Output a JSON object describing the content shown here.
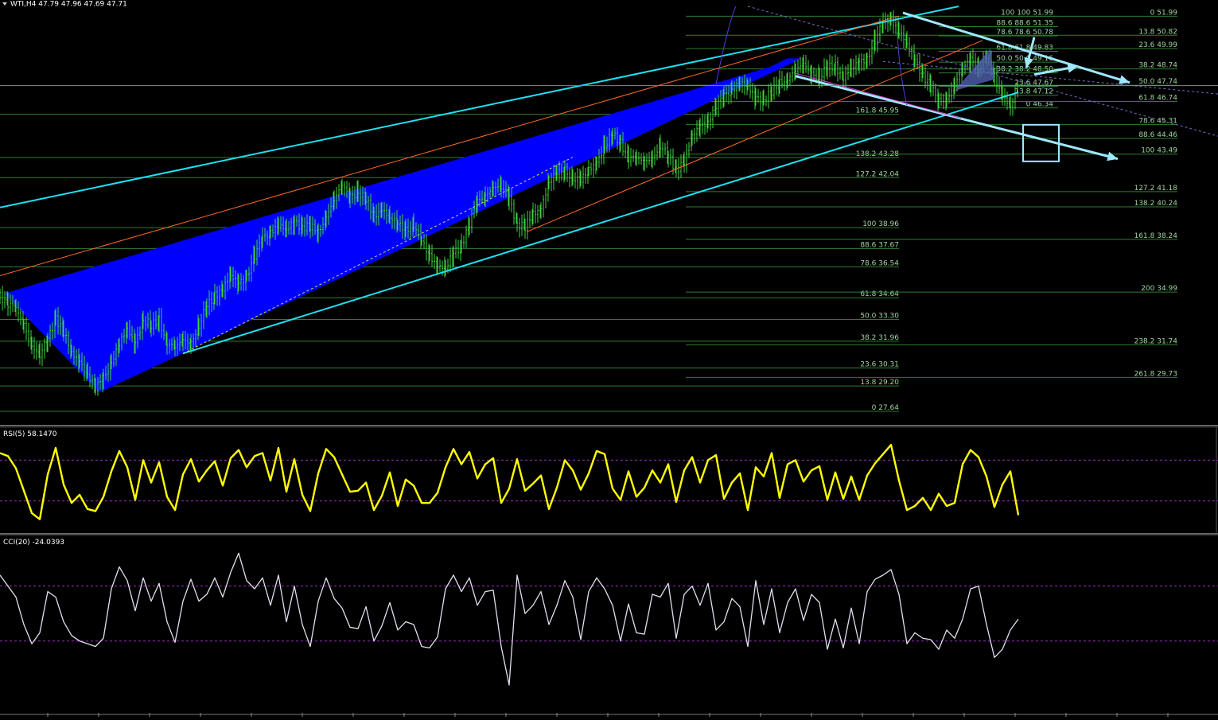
{
  "header": {
    "symbol_line": "WTI,H4  47.79 47.96 47.69 47.71"
  },
  "colors": {
    "background": "#000000",
    "price_candles": "#3fd23f",
    "fib_lines": "#2e7d32",
    "fib_text": "#9fd49f",
    "blue_wedge": "#0000ff",
    "cyan_lines": "#1fe0f0",
    "white_arrows": "#9fe8ff",
    "orange_lines": "#ff6a2a",
    "rsi_line": "#ffff00",
    "cci_line": "#e0e0f0",
    "level_lines": "#9b2fbf"
  },
  "chart_data": [
    {
      "type": "line",
      "name": "WTI H4 price",
      "ylim": [
        27.0,
        52.5
      ],
      "x": [
        0,
        10,
        20,
        30,
        40,
        50,
        60,
        70,
        80,
        90,
        100,
        110,
        120,
        130,
        140,
        150,
        160,
        170,
        180,
        190,
        200,
        210,
        220,
        230,
        240,
        250,
        260,
        270,
        280,
        290,
        300,
        310,
        320,
        330,
        340,
        350,
        360,
        370,
        380,
        390,
        400,
        410,
        420,
        430,
        440,
        450,
        460,
        470,
        480,
        490,
        500,
        510,
        520,
        530,
        540,
        550,
        560,
        570,
        580,
        590,
        600,
        610,
        620,
        630,
        640,
        650,
        660,
        670,
        680,
        690,
        700,
        710,
        720,
        730,
        740,
        750,
        760,
        770,
        780,
        790,
        800,
        810,
        820,
        830,
        840,
        850,
        860,
        870,
        880,
        890,
        900,
        910,
        920,
        930,
        940,
        950,
        960,
        970,
        980,
        990,
        1000,
        1010,
        1020,
        1030,
        1040,
        1050,
        1060,
        1070,
        1080,
        1090,
        1100,
        1110,
        1120,
        1130,
        1140,
        1150,
        1160,
        1170,
        1180,
        1190,
        1200,
        1210,
        1220,
        1230,
        1240,
        1250,
        1260,
        1270,
        1280
      ],
      "y": [
        34.8,
        34.4,
        33.8,
        33.0,
        31.8,
        31.0,
        32.0,
        33.5,
        32.6,
        31.0,
        30.8,
        30.0,
        29.0,
        29.6,
        30.8,
        31.8,
        32.5,
        32.0,
        33.3,
        32.8,
        33.2,
        32.0,
        31.5,
        31.9,
        32.0,
        32.9,
        34.0,
        34.8,
        35.4,
        35.8,
        35.5,
        36.1,
        37.2,
        38.2,
        38.8,
        39.2,
        38.6,
        39.4,
        39.1,
        39.0,
        38.5,
        39.8,
        40.7,
        41.4,
        41.0,
        41.2,
        40.6,
        39.6,
        40.3,
        39.5,
        39.1,
        38.9,
        39.2,
        38.0,
        37.2,
        36.8,
        36.3,
        37.3,
        38.0,
        39.3,
        40.4,
        41.0,
        41.6,
        41.3,
        40.8,
        39.3,
        39.0,
        39.6,
        40.3,
        41.8,
        42.2,
        42.5,
        42.1,
        41.8,
        42.4,
        43.2,
        43.9,
        44.6,
        44.2,
        43.4,
        43.1,
        43.0,
        43.4,
        43.9,
        43.3,
        42.6,
        43.2,
        44.4,
        45.3,
        45.6,
        46.4,
        47.0,
        47.6,
        47.9,
        47.4,
        47.1,
        46.9,
        47.2,
        47.8,
        48.3,
        48.6,
        48.9,
        48.6,
        48.2,
        48.7,
        48.9,
        48.4,
        48.6,
        49.1,
        49.5,
        50.5,
        51.5,
        51.9,
        51.2,
        50.1,
        49.3,
        48.5,
        47.6,
        46.6,
        47.0,
        47.8,
        48.6,
        49.4,
        48.8,
        49.5,
        48.1,
        47.3,
        46.4,
        47.4
      ]
    },
    {
      "type": "line",
      "name": "RSI(5)",
      "title": "RSI(5) 58.1470",
      "ylim": [
        0,
        100
      ],
      "levels": [
        70,
        30
      ],
      "x": [
        0,
        10,
        20,
        30,
        40,
        50,
        60,
        70,
        80,
        90,
        100,
        110,
        120,
        130,
        140,
        150,
        160,
        170,
        180,
        190,
        200,
        210,
        220,
        230,
        240,
        250,
        260,
        270,
        280,
        290,
        300,
        310,
        320,
        330,
        340,
        350,
        360,
        370,
        380,
        390,
        400,
        410,
        420,
        430,
        440,
        450,
        460,
        470,
        480,
        490,
        500,
        510,
        520,
        530,
        540,
        550,
        560,
        570,
        580,
        590,
        600,
        610,
        620,
        630,
        640,
        650,
        660,
        670,
        680,
        690,
        700,
        710,
        720,
        730,
        740,
        750,
        760,
        770,
        780,
        790,
        800,
        810,
        820,
        830,
        840,
        850,
        860,
        870,
        880,
        890,
        900,
        910,
        920,
        930,
        940,
        950,
        960,
        970,
        980,
        990,
        1000,
        1010,
        1020,
        1030,
        1040,
        1050,
        1060,
        1070,
        1080,
        1090,
        1100,
        1110,
        1120,
        1130,
        1140,
        1150,
        1160,
        1170,
        1180,
        1190,
        1200,
        1210,
        1220,
        1230,
        1240,
        1250,
        1260,
        1270,
        1280
      ],
      "y": [
        77,
        74,
        62,
        40,
        18,
        12,
        56,
        82,
        46,
        28,
        36,
        22,
        20,
        34,
        59,
        79,
        63,
        31,
        70,
        48,
        68,
        34,
        21,
        56,
        71,
        49,
        60,
        69,
        45,
        72,
        80,
        63,
        74,
        77,
        50,
        82,
        39,
        71,
        36,
        20,
        57,
        81,
        73,
        56,
        39,
        40,
        48,
        21,
        35,
        58,
        25,
        51,
        45,
        28,
        28,
        38,
        63,
        81,
        66,
        78,
        52,
        66,
        72,
        28,
        42,
        71,
        40,
        47,
        55,
        22,
        43,
        70,
        60,
        41,
        57,
        79,
        76,
        42,
        31,
        59,
        34,
        43,
        60,
        48,
        66,
        29,
        60,
        73,
        48,
        70,
        75,
        32,
        48,
        57,
        21,
        63,
        54,
        77,
        33,
        66,
        70,
        49,
        60,
        64,
        31,
        58,
        32,
        54,
        31,
        55,
        67,
        76,
        85,
        50,
        21,
        25,
        33,
        21,
        37,
        25,
        28,
        66,
        80,
        73,
        54,
        24,
        46,
        59,
        16,
        38,
        62
      ]
    },
    {
      "type": "line",
      "name": "CCI(20)",
      "title": "CCI(20) -24.0393",
      "ylim": [
        -350,
        270
      ],
      "levels": [
        100,
        -100
      ],
      "x": [
        0,
        10,
        20,
        30,
        40,
        50,
        60,
        70,
        80,
        90,
        100,
        110,
        120,
        130,
        140,
        150,
        160,
        170,
        180,
        190,
        200,
        210,
        220,
        230,
        240,
        250,
        260,
        270,
        280,
        290,
        300,
        310,
        320,
        330,
        340,
        350,
        360,
        370,
        380,
        390,
        400,
        410,
        420,
        430,
        440,
        450,
        460,
        470,
        480,
        490,
        500,
        510,
        520,
        530,
        540,
        550,
        560,
        570,
        580,
        590,
        600,
        610,
        620,
        630,
        640,
        650,
        660,
        670,
        680,
        690,
        700,
        710,
        720,
        730,
        740,
        750,
        760,
        770,
        780,
        790,
        800,
        810,
        820,
        830,
        840,
        850,
        860,
        870,
        880,
        890,
        900,
        910,
        920,
        930,
        940,
        950,
        960,
        970,
        980,
        990,
        1000,
        1010,
        1020,
        1030,
        1040,
        1050,
        1060,
        1070,
        1080,
        1090,
        1100,
        1110,
        1120,
        1130,
        1140,
        1150,
        1160,
        1170,
        1180,
        1190,
        1200,
        1210,
        1220,
        1230,
        1240,
        1250,
        1260,
        1270,
        1280
      ],
      "y": [
        140,
        100,
        60,
        -40,
        -110,
        -70,
        80,
        60,
        -30,
        -80,
        -100,
        -110,
        -120,
        -90,
        90,
        170,
        120,
        10,
        130,
        45,
        110,
        -30,
        -105,
        45,
        125,
        45,
        70,
        130,
        60,
        150,
        220,
        120,
        90,
        130,
        30,
        140,
        -30,
        100,
        -40,
        -120,
        45,
        130,
        55,
        20,
        -50,
        -55,
        25,
        -100,
        -45,
        40,
        -60,
        -30,
        -40,
        -120,
        -125,
        -85,
        90,
        140,
        80,
        130,
        30,
        80,
        85,
        -120,
        -260,
        140,
        0,
        30,
        80,
        -40,
        30,
        120,
        60,
        -95,
        80,
        130,
        90,
        30,
        -100,
        35,
        -70,
        -75,
        70,
        60,
        110,
        -90,
        70,
        100,
        30,
        110,
        -60,
        -30,
        55,
        25,
        -120,
        120,
        -40,
        90,
        -70,
        40,
        90,
        -25,
        70,
        40,
        -130,
        -20,
        -125,
        20,
        -110,
        80,
        125,
        140,
        160,
        70,
        -110,
        -70,
        -90,
        -95,
        -130,
        -60,
        -90,
        -20,
        90,
        100,
        -40,
        -160,
        -130,
        -60,
        -20
      ]
    }
  ],
  "fib_left": [
    {
      "label": "161.8 45.95"
    },
    {
      "label": "138.2 43.28"
    },
    {
      "label": "127.2 42.04"
    },
    {
      "label": "100 38.96"
    },
    {
      "label": "88.6 37.67"
    },
    {
      "label": "78.6 36.54"
    },
    {
      "label": "61.8 34.64"
    },
    {
      "label": "50.0 33.30"
    },
    {
      "label": "38.2 31.96"
    },
    {
      "label": "23.6 30.31"
    },
    {
      "label": "13.8 29.20"
    },
    {
      "label": "0 27.64"
    }
  ],
  "fib_mid": [
    {
      "label": "100 100 51.99"
    },
    {
      "label": "88.6 88.6 51.35"
    },
    {
      "label": "78.6 78.6 50.78"
    },
    {
      "label": "61.8 61.8 49.83"
    },
    {
      "label": "50.0 50.0 49.16"
    },
    {
      "label": "38.2 38.2 48.50"
    },
    {
      "label": "23.6 47.67"
    },
    {
      "label": "13.8 47.12"
    },
    {
      "label": "0 46.34"
    }
  ],
  "fib_right": [
    {
      "label": "0 51.99"
    },
    {
      "label": "13.8 50.82"
    },
    {
      "label": "23.6 49.99"
    },
    {
      "label": "38.2 48.74"
    },
    {
      "label": "50.0 47.74"
    },
    {
      "label": "61.8 46.74"
    },
    {
      "label": "78.6 45.31"
    },
    {
      "label": "88.6 44.46"
    },
    {
      "label": "100 43.49"
    },
    {
      "label": "127.2 41.18"
    },
    {
      "label": "138.2 40.24"
    },
    {
      "label": "161.8 38.24"
    },
    {
      "label": "200 34.99"
    },
    {
      "label": "238.2 31.74"
    },
    {
      "label": "261.8 29.73"
    }
  ]
}
